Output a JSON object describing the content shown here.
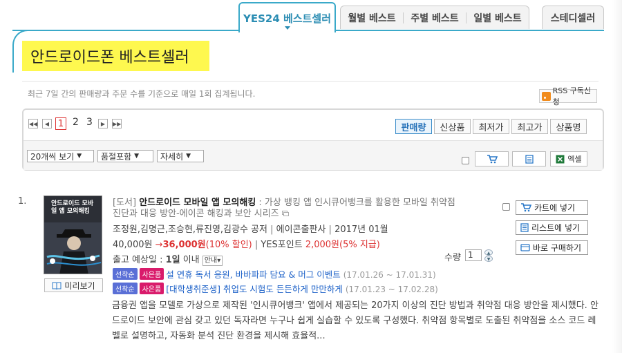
{
  "tabs": {
    "active": "YES24 베스트셀러",
    "group": [
      "월별 베스트",
      "주별 베스트",
      "일별 베스트"
    ],
    "study": "스테디셀러"
  },
  "page_title": "안드로이드폰 베스트셀러",
  "description": "최근 7일 간의 판매량과 주문 수를 기준으로 매일 1회 집계됩니다.",
  "rss_label": "RSS 구독신청",
  "pagination": {
    "pages": [
      "1",
      "2",
      "3"
    ],
    "current": "1",
    "first_icon": "double-left-icon",
    "prev_icon": "left-icon",
    "next_icon": "right-icon",
    "last_icon": "double-right-icon"
  },
  "sort": {
    "options": [
      "판매량",
      "신상품",
      "최저가",
      "최고가",
      "상품명"
    ],
    "active": "판매량"
  },
  "filters": {
    "view_count": "20개씩 보기",
    "soldout": "품절포함",
    "detail": "자세히"
  },
  "toolbar": {
    "cart_icon": "cart-icon",
    "list_icon": "list-icon",
    "excel_label": "엑셀"
  },
  "item": {
    "rank": "1.",
    "category": "[도서]",
    "title": "안드로이드 모바일 앱 모의해킹",
    "subtitle_1": " : 가상 뱅킹 앱 인시큐어뱅크를 활용한 모바일 취약점",
    "subtitle_2": "진단과 대응 방안-에이콘 해킹과 보안 시리즈",
    "cover_title": "안드로이드 모바일 앱 모의해킹",
    "authors": "조정원,김명근,조승현,류진영,김광수 공저",
    "publisher": "에이콘출판사",
    "date": "2017년 01월",
    "price_original": "40,000원",
    "price_arrow": "→",
    "price_sale": "36,000원",
    "discount": "(10% 할인)",
    "points_label": "YES포인트",
    "points": "2,000원",
    "points_rate": "(5% 지급)",
    "ship_label": "출고 예상일 : ",
    "ship_value": "1일",
    "ship_suffix": " 이내",
    "ship_info": "안내",
    "quantity_label": "수량",
    "quantity": "1",
    "preview_label": "미리보기",
    "events": [
      {
        "badge1": "선착순",
        "badge2": "사은품",
        "text": "설 연휴 독서 응원, 바바파파 담요 & 머그 이벤트",
        "dates": "(17.01.26 ~ 17.01.31)"
      },
      {
        "badge1": "선착순",
        "badge2": "사은품",
        "text": "[대학생취준생] 취업도 시험도 든든하게 만만하게",
        "dates": "(17.01.23 ~ 17.02.28)"
      }
    ],
    "actions": {
      "cart": "카트에 넣기",
      "list": "리스트에 넣기",
      "buy": "바로 구매하기"
    },
    "summary": "금융권 앱을 모델로 가상으로 제작된 '인시큐어뱅크' 앱에서 제공되는 20가지 이상의 진단 방법과 취약점 대응 방안을 제시했다. 안드로이드 보안에 관심 갖고 있던 독자라면 누구나 쉽게 실습할 수 있도록 구성했다. 취약점 항목별로 도출된 취약점을 소스 코드 레벨로 설명하고, 자동화 분석 진단 환경을 제시해 효율적..."
  },
  "colors": {
    "accent": "#3aa9c9",
    "title_highlight": "#fef84f",
    "price_red": "#dd3333",
    "badge_blue": "#5a6fd6",
    "badge_pink": "#d91b6b",
    "link_blue": "#1e62c8"
  }
}
